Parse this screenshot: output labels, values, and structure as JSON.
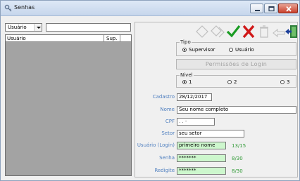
{
  "window": {
    "title": "Senhas"
  },
  "filter": {
    "field_selected": "Usuário",
    "search_value": ""
  },
  "grid": {
    "columns": [
      "Usuário",
      "Sup."
    ],
    "rows": []
  },
  "toolbar": {
    "icons": [
      "diamond-outline-icon",
      "double-diamond-outline-icon",
      "checkmark-icon",
      "cancel-x-icon",
      "trash-can-icon",
      "arrow-hand-icon",
      "exit-door-icon"
    ],
    "colors": {
      "confirm": "#1a9c23",
      "cancel": "#d01818",
      "exit": "#2d7d3a",
      "disabled": "#bfbfbf"
    }
  },
  "tipo": {
    "legend": "Tipo",
    "options": [
      {
        "label": "Supervisor",
        "selected": true
      },
      {
        "label": "Usuário",
        "selected": false
      }
    ]
  },
  "permissoes_button": "Permissões de Login",
  "nivel": {
    "legend": "Nivel",
    "options": [
      {
        "label": "1",
        "selected": true
      },
      {
        "label": "2",
        "selected": false
      },
      {
        "label": "3",
        "selected": false
      }
    ]
  },
  "form": {
    "cadastro": {
      "label": "Cadastro",
      "value": "28/12/2017"
    },
    "nome": {
      "label": "Nome",
      "value": "Seu nome completo"
    },
    "cpf": {
      "label": "CPF",
      "value": " .  .  -"
    },
    "setor": {
      "label": "Setor",
      "value": "seu setor"
    },
    "usuario_login": {
      "label": "Usuário (Login)",
      "value": "primeiro nome",
      "count": "13/15"
    },
    "senha": {
      "label": "Senha",
      "value": "*******",
      "count": "8/30"
    },
    "redigite": {
      "label": "Redigite",
      "value": "*******",
      "count": "8/30"
    }
  }
}
